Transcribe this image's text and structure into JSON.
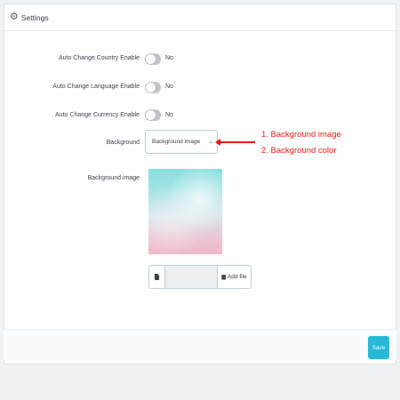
{
  "panel": {
    "title": "Settings",
    "icon": "gears-icon"
  },
  "fields": [
    {
      "label": "Auto Change Country Enable",
      "switch_state": "No"
    },
    {
      "label": "Auto Change Language Enable",
      "switch_state": "No"
    },
    {
      "label": "Auto Change Currency Enable",
      "switch_state": "No"
    }
  ],
  "background": {
    "label": "Background",
    "selected": "Background image"
  },
  "background_image": {
    "label": "Background image",
    "add_file_label": "Add file"
  },
  "annotation": {
    "line1": "1. Background image",
    "line2": "2. Background color",
    "color": "#e3120b"
  },
  "footer": {
    "save_label": "Save",
    "accent": "#25b9d7"
  }
}
